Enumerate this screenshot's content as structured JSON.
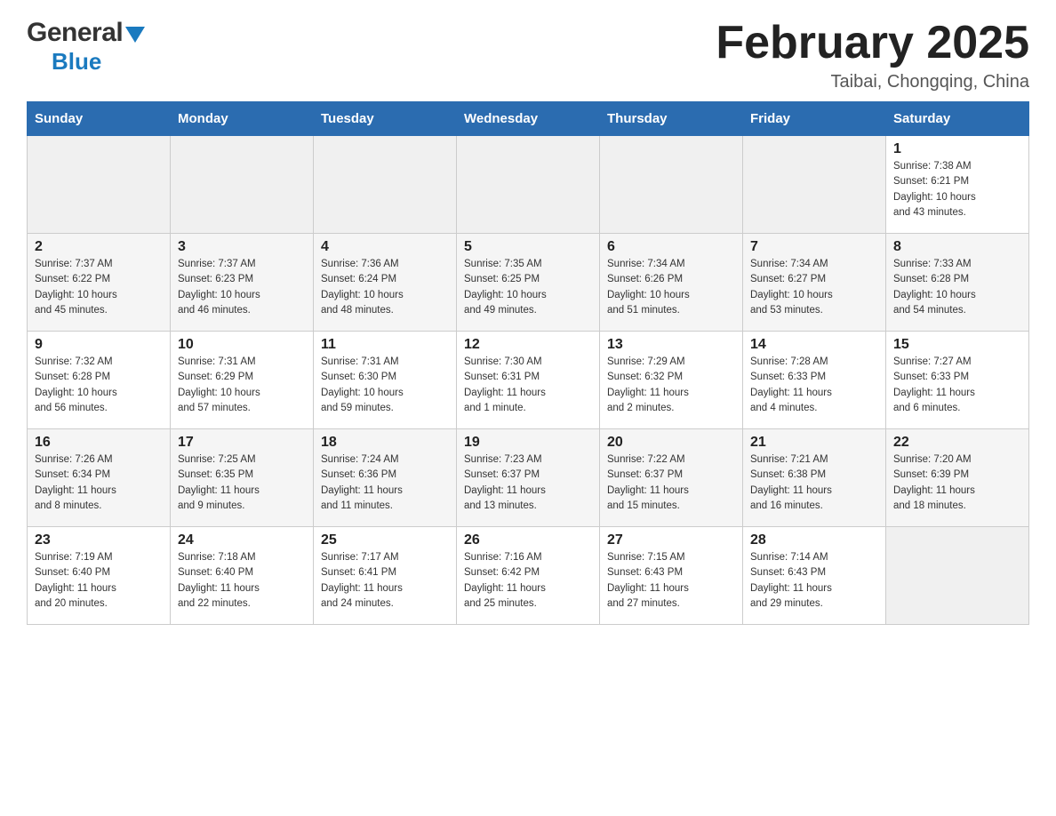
{
  "header": {
    "logo": {
      "general": "General",
      "blue": "Blue"
    },
    "title": "February 2025",
    "location": "Taibai, Chongqing, China"
  },
  "weekdays": [
    "Sunday",
    "Monday",
    "Tuesday",
    "Wednesday",
    "Thursday",
    "Friday",
    "Saturday"
  ],
  "weeks": [
    [
      {
        "day": "",
        "info": ""
      },
      {
        "day": "",
        "info": ""
      },
      {
        "day": "",
        "info": ""
      },
      {
        "day": "",
        "info": ""
      },
      {
        "day": "",
        "info": ""
      },
      {
        "day": "",
        "info": ""
      },
      {
        "day": "1",
        "info": "Sunrise: 7:38 AM\nSunset: 6:21 PM\nDaylight: 10 hours\nand 43 minutes."
      }
    ],
    [
      {
        "day": "2",
        "info": "Sunrise: 7:37 AM\nSunset: 6:22 PM\nDaylight: 10 hours\nand 45 minutes."
      },
      {
        "day": "3",
        "info": "Sunrise: 7:37 AM\nSunset: 6:23 PM\nDaylight: 10 hours\nand 46 minutes."
      },
      {
        "day": "4",
        "info": "Sunrise: 7:36 AM\nSunset: 6:24 PM\nDaylight: 10 hours\nand 48 minutes."
      },
      {
        "day": "5",
        "info": "Sunrise: 7:35 AM\nSunset: 6:25 PM\nDaylight: 10 hours\nand 49 minutes."
      },
      {
        "day": "6",
        "info": "Sunrise: 7:34 AM\nSunset: 6:26 PM\nDaylight: 10 hours\nand 51 minutes."
      },
      {
        "day": "7",
        "info": "Sunrise: 7:34 AM\nSunset: 6:27 PM\nDaylight: 10 hours\nand 53 minutes."
      },
      {
        "day": "8",
        "info": "Sunrise: 7:33 AM\nSunset: 6:28 PM\nDaylight: 10 hours\nand 54 minutes."
      }
    ],
    [
      {
        "day": "9",
        "info": "Sunrise: 7:32 AM\nSunset: 6:28 PM\nDaylight: 10 hours\nand 56 minutes."
      },
      {
        "day": "10",
        "info": "Sunrise: 7:31 AM\nSunset: 6:29 PM\nDaylight: 10 hours\nand 57 minutes."
      },
      {
        "day": "11",
        "info": "Sunrise: 7:31 AM\nSunset: 6:30 PM\nDaylight: 10 hours\nand 59 minutes."
      },
      {
        "day": "12",
        "info": "Sunrise: 7:30 AM\nSunset: 6:31 PM\nDaylight: 11 hours\nand 1 minute."
      },
      {
        "day": "13",
        "info": "Sunrise: 7:29 AM\nSunset: 6:32 PM\nDaylight: 11 hours\nand 2 minutes."
      },
      {
        "day": "14",
        "info": "Sunrise: 7:28 AM\nSunset: 6:33 PM\nDaylight: 11 hours\nand 4 minutes."
      },
      {
        "day": "15",
        "info": "Sunrise: 7:27 AM\nSunset: 6:33 PM\nDaylight: 11 hours\nand 6 minutes."
      }
    ],
    [
      {
        "day": "16",
        "info": "Sunrise: 7:26 AM\nSunset: 6:34 PM\nDaylight: 11 hours\nand 8 minutes."
      },
      {
        "day": "17",
        "info": "Sunrise: 7:25 AM\nSunset: 6:35 PM\nDaylight: 11 hours\nand 9 minutes."
      },
      {
        "day": "18",
        "info": "Sunrise: 7:24 AM\nSunset: 6:36 PM\nDaylight: 11 hours\nand 11 minutes."
      },
      {
        "day": "19",
        "info": "Sunrise: 7:23 AM\nSunset: 6:37 PM\nDaylight: 11 hours\nand 13 minutes."
      },
      {
        "day": "20",
        "info": "Sunrise: 7:22 AM\nSunset: 6:37 PM\nDaylight: 11 hours\nand 15 minutes."
      },
      {
        "day": "21",
        "info": "Sunrise: 7:21 AM\nSunset: 6:38 PM\nDaylight: 11 hours\nand 16 minutes."
      },
      {
        "day": "22",
        "info": "Sunrise: 7:20 AM\nSunset: 6:39 PM\nDaylight: 11 hours\nand 18 minutes."
      }
    ],
    [
      {
        "day": "23",
        "info": "Sunrise: 7:19 AM\nSunset: 6:40 PM\nDaylight: 11 hours\nand 20 minutes."
      },
      {
        "day": "24",
        "info": "Sunrise: 7:18 AM\nSunset: 6:40 PM\nDaylight: 11 hours\nand 22 minutes."
      },
      {
        "day": "25",
        "info": "Sunrise: 7:17 AM\nSunset: 6:41 PM\nDaylight: 11 hours\nand 24 minutes."
      },
      {
        "day": "26",
        "info": "Sunrise: 7:16 AM\nSunset: 6:42 PM\nDaylight: 11 hours\nand 25 minutes."
      },
      {
        "day": "27",
        "info": "Sunrise: 7:15 AM\nSunset: 6:43 PM\nDaylight: 11 hours\nand 27 minutes."
      },
      {
        "day": "28",
        "info": "Sunrise: 7:14 AM\nSunset: 6:43 PM\nDaylight: 11 hours\nand 29 minutes."
      },
      {
        "day": "",
        "info": ""
      }
    ]
  ]
}
